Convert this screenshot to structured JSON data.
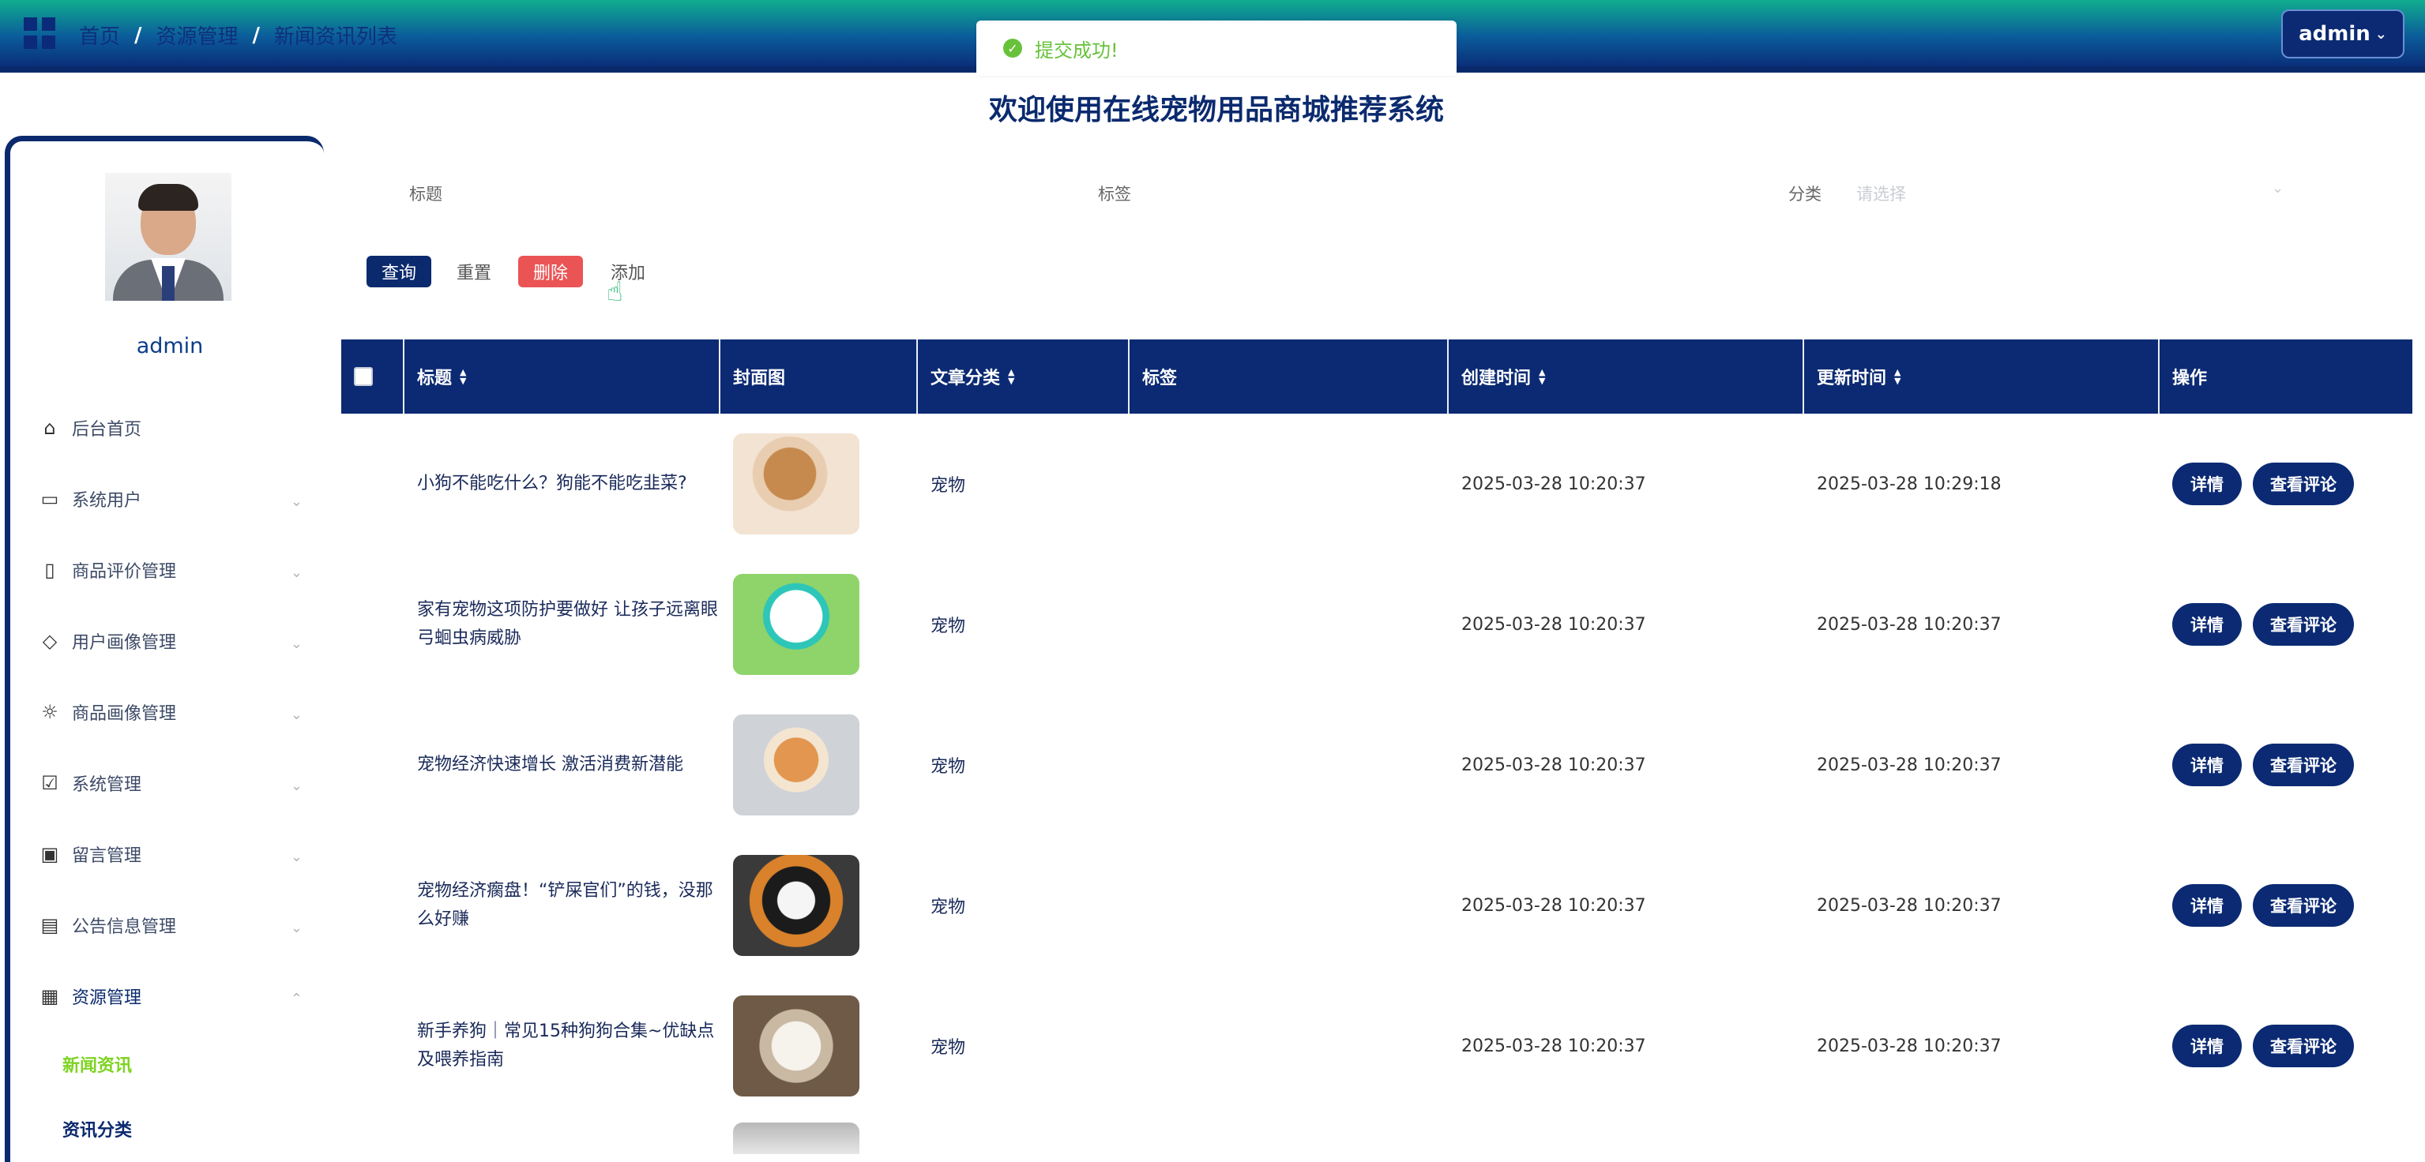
{
  "breadcrumb": [
    "首页",
    "资源管理",
    "新闻资讯列表"
  ],
  "breadcrumb_sep": "/",
  "admin_menu": "admin",
  "toast": "提交成功!",
  "welcome": "欢迎使用在线宠物用品商城推荐系统",
  "sidebar": {
    "username": "admin",
    "items": [
      {
        "label": "后台首页",
        "icon": "home-icon"
      },
      {
        "label": "系统用户",
        "icon": "monitor-icon"
      },
      {
        "label": "商品评价管理",
        "icon": "bookmark-icon"
      },
      {
        "label": "用户画像管理",
        "icon": "tag-icon"
      },
      {
        "label": "商品画像管理",
        "icon": "sun-icon"
      },
      {
        "label": "系统管理",
        "icon": "inbox-icon"
      },
      {
        "label": "留言管理",
        "icon": "clipboard-icon"
      },
      {
        "label": "公告信息管理",
        "icon": "message-icon"
      },
      {
        "label": "资源管理",
        "icon": "archive-icon"
      }
    ],
    "subitems": [
      "新闻资讯",
      "资讯分类"
    ]
  },
  "search": {
    "title_label": "标题",
    "tag_label": "标签",
    "category_label": "分类",
    "category_placeholder": "请选择"
  },
  "toolbar": {
    "query": "查询",
    "reset": "重置",
    "delete": "删除",
    "add": "添加"
  },
  "table": {
    "headers": [
      "标题",
      "封面图",
      "文章分类",
      "标签",
      "创建时间",
      "更新时间",
      "操作"
    ],
    "detail_label": "详情",
    "comments_label": "查看评论",
    "rows": [
      {
        "title": "小狗不能吃什么？狗能不能吃韭菜?",
        "category": "宠物",
        "tag": "",
        "created": "2025-03-28 10:20:37",
        "updated": "2025-03-28 10:29:18"
      },
      {
        "title": "家有宠物这项防护要做好 让孩子远离眼弓蛔虫病威胁",
        "category": "宠物",
        "tag": "",
        "created": "2025-03-28 10:20:37",
        "updated": "2025-03-28 10:20:37"
      },
      {
        "title": "宠物经济快速增长 激活消费新潜能",
        "category": "宠物",
        "tag": "",
        "created": "2025-03-28 10:20:37",
        "updated": "2025-03-28 10:20:37"
      },
      {
        "title": "宠物经济瘸盘！“铲屎官们”的钱，没那么好赚",
        "category": "宠物",
        "tag": "",
        "created": "2025-03-28 10:20:37",
        "updated": "2025-03-28 10:20:37"
      },
      {
        "title": "新手养狗｜常见15种狗狗合集~优缺点及喂养指南",
        "category": "宠物",
        "tag": "",
        "created": "2025-03-28 10:20:37",
        "updated": "2025-03-28 10:20:37"
      }
    ]
  }
}
